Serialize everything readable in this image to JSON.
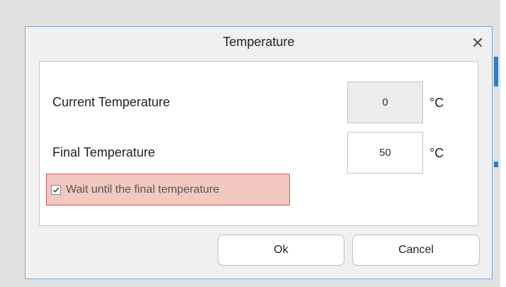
{
  "dialog": {
    "title": "Temperature",
    "close_glyph": "✕"
  },
  "fields": {
    "current": {
      "label": "Current Temperature",
      "value": "0",
      "unit": "°C",
      "editable": false
    },
    "final": {
      "label": "Final Temperature",
      "value": "50",
      "unit": "°C",
      "editable": true
    }
  },
  "wait": {
    "label": "Wait until the final temperature",
    "checked": true,
    "check_glyph": "✓",
    "highlight_color": "#f3c8c0",
    "highlight_border": "#d9534f"
  },
  "buttons": {
    "ok": "Ok",
    "cancel": "Cancel"
  },
  "icons": {
    "close": "close-icon",
    "checkbox": "checkmark-icon"
  }
}
